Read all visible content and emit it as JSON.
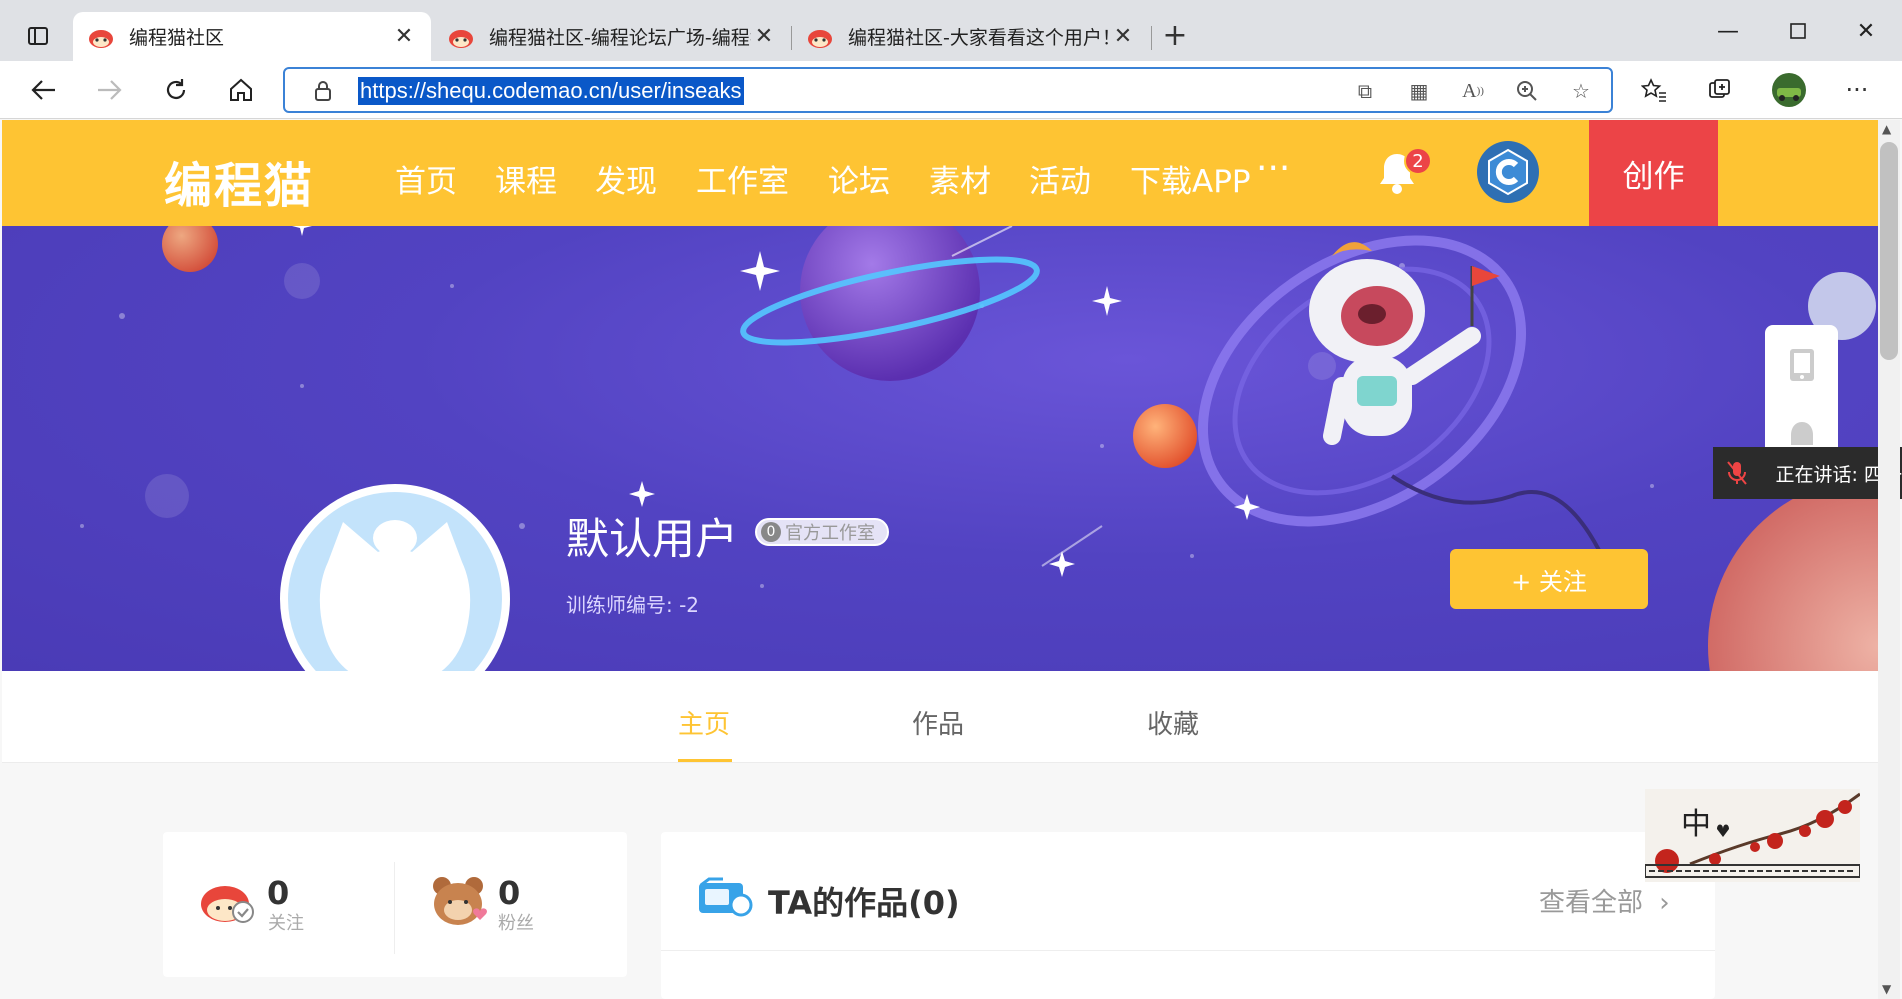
{
  "browser": {
    "tabs": [
      {
        "title": "编程猫社区",
        "active": true
      },
      {
        "title": "编程猫社区-编程论坛广场-编程猫",
        "active": false
      },
      {
        "title": "编程猫社区-大家看看这个用户！",
        "active": false
      }
    ],
    "url": "https://shequ.codemao.cn/user/inseaks"
  },
  "site": {
    "logo": "编程猫",
    "nav": [
      "首页",
      "课程",
      "发现",
      "工作室",
      "论坛",
      "素材",
      "活动",
      "下载APP",
      "···"
    ],
    "notification_count": "2",
    "create_label": "创作"
  },
  "profile": {
    "name": "默认用户",
    "tag_count": "0",
    "tag_label": "官方工作室",
    "trainer_id": "训练师编号: -2",
    "follow_label": "+ 关注"
  },
  "profile_tabs": [
    "主页",
    "作品",
    "收藏"
  ],
  "stats": {
    "following": {
      "value": "0",
      "label": "关注"
    },
    "fans": {
      "value": "0",
      "label": "粉丝"
    }
  },
  "works": {
    "title": "TA的作品(0)",
    "view_all": "查看全部"
  },
  "overlay": {
    "speaking": "正在讲话: 四一",
    "deco_char": "中"
  },
  "colors": {
    "brand_yellow": "#fec433",
    "create_red": "#ec4447",
    "banner_purple": "#5243c2",
    "url_highlight": "#0a58c8"
  }
}
